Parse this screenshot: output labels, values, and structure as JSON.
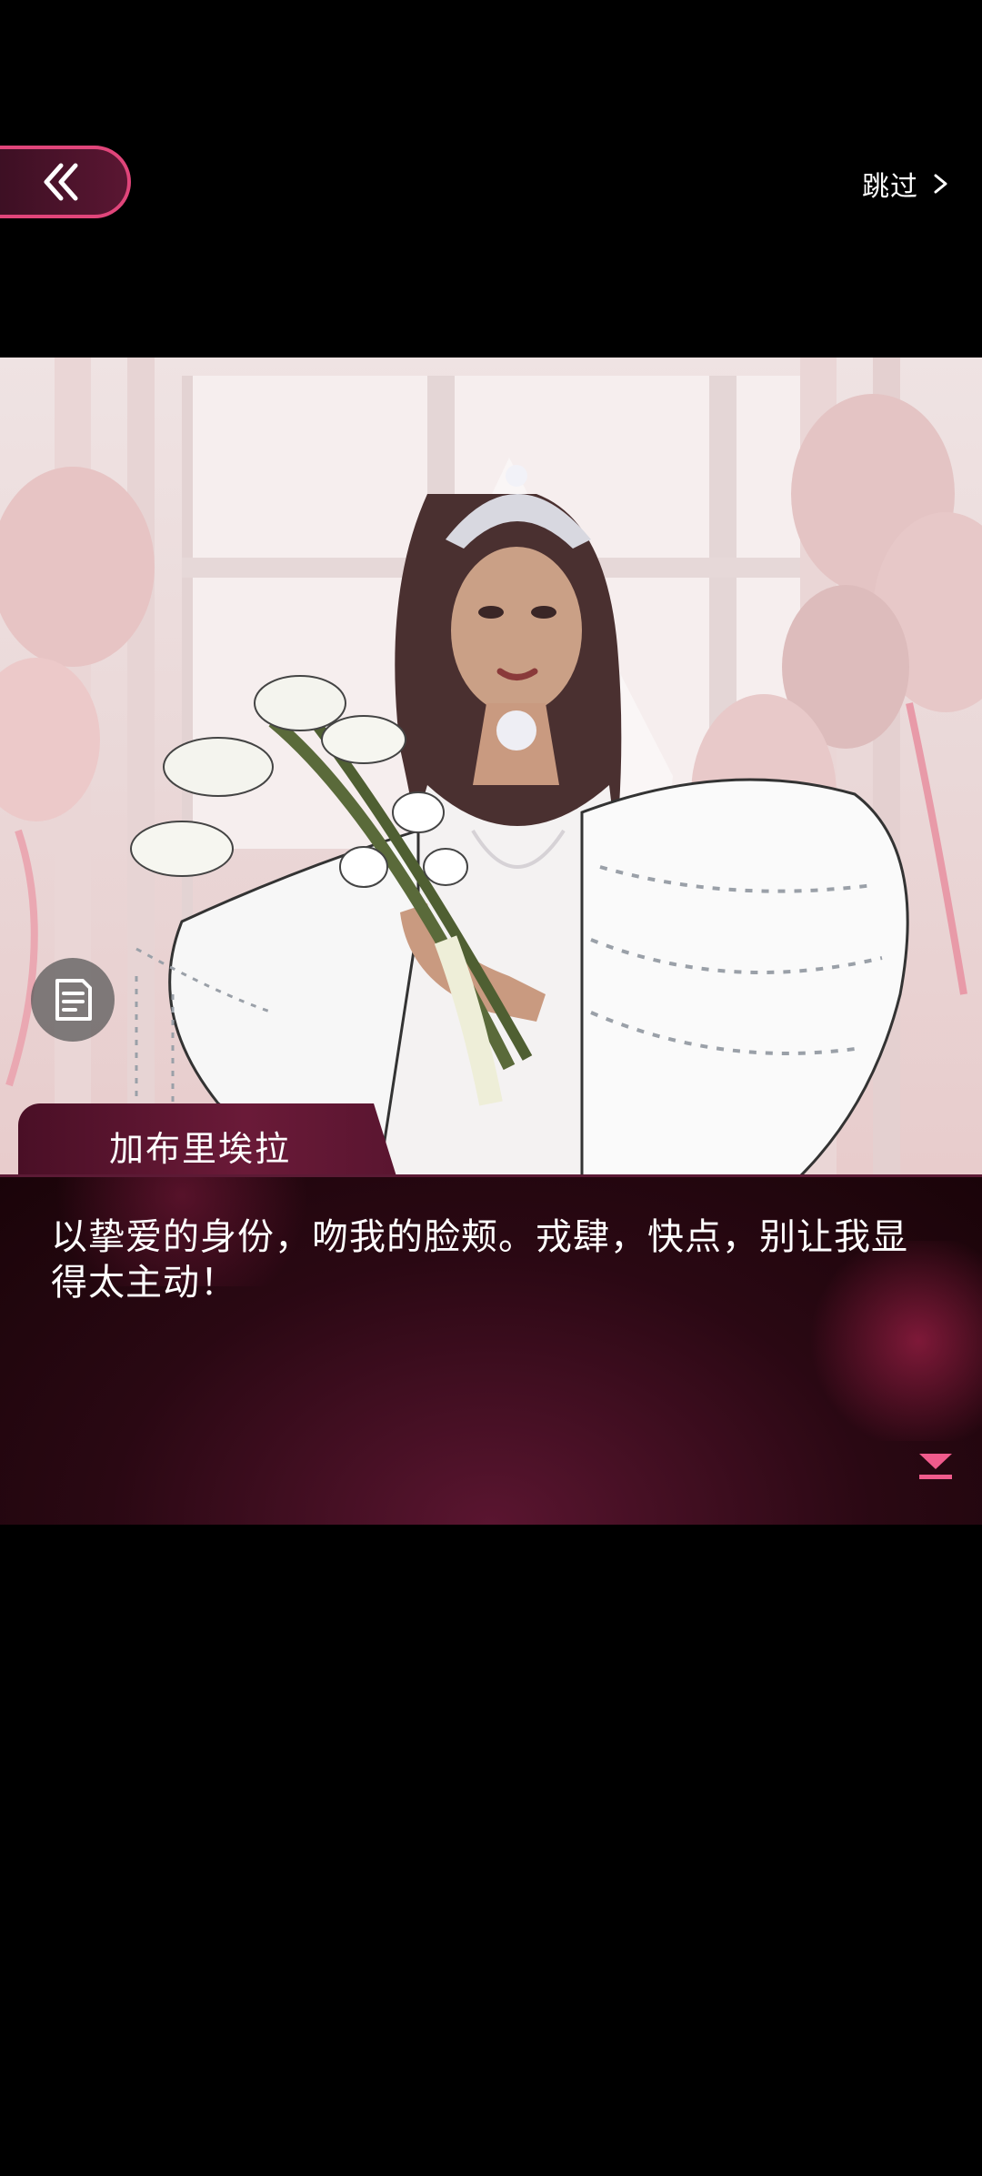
{
  "topbar": {
    "skip_label": "跳过",
    "back_icon": "double-chevron-left-icon",
    "skip_icon": "chevron-right-icon"
  },
  "dialog": {
    "speaker": "加布里埃拉",
    "line": "以挚爱的身份，吻我的脸颊。戎肆，快点，别让我显得太主动！"
  },
  "colors": {
    "accent": "#e0457a",
    "dialog_bg": "#2a0813",
    "name_tab_bg": "#5a1530",
    "next_indicator": "#f05b8c"
  }
}
